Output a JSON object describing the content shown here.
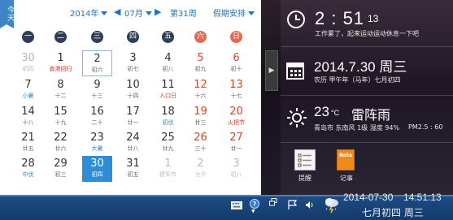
{
  "calendar": {
    "today_tab": "今天",
    "year": "2014年",
    "month": "07月",
    "week_number": "第31周",
    "holiday": "假期安排",
    "weekdays": [
      "一",
      "二",
      "三",
      "四",
      "五",
      "六",
      "日"
    ],
    "weeks": [
      [
        {
          "n": "30",
          "s": "初四",
          "t": "other"
        },
        {
          "n": "1",
          "s": "香港回归",
          "t": "festival"
        },
        {
          "n": "2",
          "s": "初六",
          "t": "today"
        },
        {
          "n": "3",
          "s": "初七"
        },
        {
          "n": "4",
          "s": "初八"
        },
        {
          "n": "5",
          "s": "初九",
          "t": "weekend"
        },
        {
          "n": "6",
          "s": "初十",
          "t": "weekend"
        }
      ],
      [
        {
          "n": "7",
          "s": "小暑",
          "t": "term"
        },
        {
          "n": "8",
          "s": "十二"
        },
        {
          "n": "9",
          "s": "十三"
        },
        {
          "n": "10",
          "s": "十四"
        },
        {
          "n": "11",
          "s": "入口日",
          "t": "festival"
        },
        {
          "n": "12",
          "s": "十六",
          "t": "weekend"
        },
        {
          "n": "13",
          "s": "十七",
          "t": "weekend"
        }
      ],
      [
        {
          "n": "14",
          "s": "十八"
        },
        {
          "n": "15",
          "s": "十九"
        },
        {
          "n": "16",
          "s": "二十"
        },
        {
          "n": "17",
          "s": "廿一"
        },
        {
          "n": "18",
          "s": "初伏",
          "t": "term"
        },
        {
          "n": "19",
          "s": "廿三",
          "t": "weekend"
        },
        {
          "n": "20",
          "s": "火把节",
          "t": "weekend festival"
        }
      ],
      [
        {
          "n": "21",
          "s": "廿五"
        },
        {
          "n": "22",
          "s": "廿六"
        },
        {
          "n": "23",
          "s": "大暑",
          "t": "term"
        },
        {
          "n": "24",
          "s": "廿八"
        },
        {
          "n": "25",
          "s": "廿九"
        },
        {
          "n": "26",
          "s": "三十",
          "t": "weekend"
        },
        {
          "n": "27",
          "s": "廿一",
          "t": "weekend"
        }
      ],
      [
        {
          "n": "28",
          "s": "中伏",
          "t": "term"
        },
        {
          "n": "29",
          "s": "初三"
        },
        {
          "n": "30",
          "s": "初四",
          "t": "selected"
        },
        {
          "n": "31",
          "s": "初五"
        },
        {
          "n": "1",
          "s": "建军节",
          "t": "other"
        },
        {
          "n": "2",
          "s": "七夕",
          "t": "other"
        },
        {
          "n": "3",
          "s": "初八",
          "t": "other"
        }
      ]
    ]
  },
  "side": {
    "time": "2 : 51",
    "seconds": "13",
    "time_note": "工作累了，起来运动运动休息一下吧",
    "date": "2014.7.30 周三",
    "lunar": "农历 甲午年（马年）七月初四",
    "temp": "23",
    "temp_unit": "°C",
    "weather": "雷阵雨",
    "city_line": "青岛市 东南风 1级 湿度 94%",
    "pm": "PM2.5 : 60",
    "app1_label": "提醒",
    "app2_label": "记事",
    "note_icon_text": "Note",
    "expand_glyph": "▶"
  },
  "taskbar": {
    "date": "2014-07-30",
    "time": "14:51:13",
    "lunar_line": "七月初四 周三"
  }
}
